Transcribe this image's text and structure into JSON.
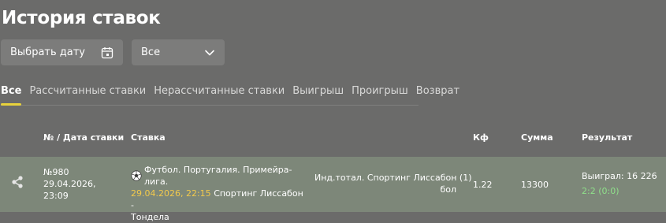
{
  "page": {
    "title": "История ставок"
  },
  "filters": {
    "date_placeholder": "Выбрать дату",
    "type_value": "Все"
  },
  "tabs": [
    {
      "label": "Все",
      "active": true
    },
    {
      "label": "Рассчитанные ставки"
    },
    {
      "label": "Нерассчитанные ставки"
    },
    {
      "label": "Выигрыш"
    },
    {
      "label": "Проигрыш"
    },
    {
      "label": "Возврат"
    }
  ],
  "table": {
    "headers": {
      "number_date": "№ / Дата ставки",
      "bet": "Ставка",
      "coef": "Кф",
      "amount": "Сумма",
      "result": "Результат"
    },
    "rows": [
      {
        "number": "№980",
        "date": "29.04.2026,",
        "time": "23:09",
        "league": "Футбол. Португалия. Примейра-лига.",
        "event_datetime": "29.04.2026, 22:15",
        "event_line2": "Спортинг Лиссабон -",
        "event_line3": "Тондела",
        "outcome_line1": "Инд.тотал. Спортинг Лиссабон (1)",
        "outcome_line2": "бол",
        "coef": "1.22",
        "amount": "13300",
        "result": "Выиграл: 16 226",
        "score": "2:2 (0:0)"
      }
    ]
  },
  "colors": {
    "background": "#6b6b6a",
    "row_background": "#7d8779",
    "accent_yellow": "#e8d23c",
    "win_green": "#8fe08a"
  },
  "icons": {
    "calendar": "calendar-icon",
    "dropdown": "chevron-down-icon",
    "share": "share-icon",
    "sport": "soccer-ball-icon"
  }
}
